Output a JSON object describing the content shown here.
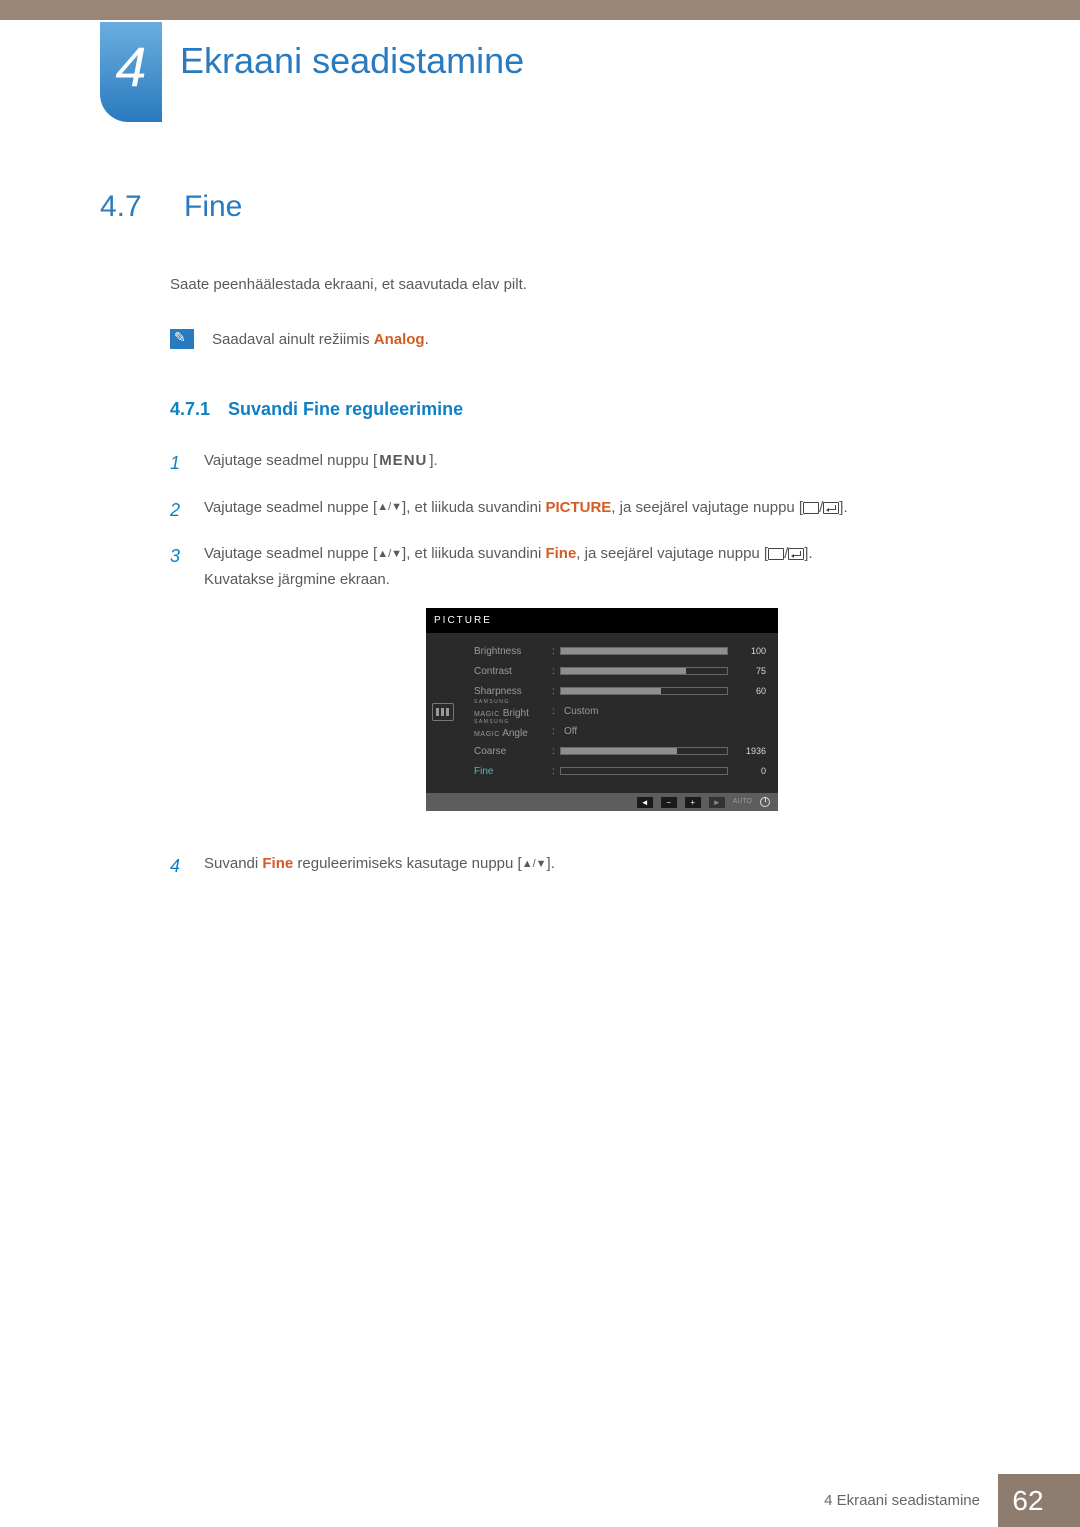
{
  "chapter": {
    "number": "4",
    "title": "Ekraani seadistamine"
  },
  "section": {
    "number": "4.7",
    "title": "Fine"
  },
  "intro": "Saate peenhäälestada ekraani, et saavutada elav pilt.",
  "note": {
    "prefix": "Saadaval ainult režiimis ",
    "keyword": "Analog",
    "suffix": "."
  },
  "subsection": {
    "number": "4.7.1",
    "title": "Suvandi Fine reguleerimine"
  },
  "keys": {
    "menu": "MENU"
  },
  "steps": {
    "s1": {
      "n": "1",
      "text_a": "Vajutage seadmel nuppu [",
      "text_b": "]."
    },
    "s2": {
      "n": "2",
      "a": "Vajutage seadmel nuppe [",
      "b": "], et liikuda suvandini ",
      "kw": "PICTURE",
      "c": ", ja seejärel vajutage nuppu [",
      "d": "]."
    },
    "s3": {
      "n": "3",
      "a": "Vajutage seadmel nuppe [",
      "b": "], et liikuda suvandini ",
      "kw": "Fine",
      "c": ", ja seejärel vajutage nuppu [",
      "d": "].",
      "after": "Kuvatakse järgmine ekraan."
    },
    "s4": {
      "n": "4",
      "a": "Suvandi ",
      "kw": "Fine",
      "b": " reguleerimiseks kasutage nuppu [",
      "c": "]."
    }
  },
  "osd": {
    "header": "PICTURE",
    "rows": {
      "brightness": {
        "label": "Brightness",
        "value": "100",
        "pct": 100
      },
      "contrast": {
        "label": "Contrast",
        "value": "75",
        "pct": 75
      },
      "sharpness": {
        "label": "Sharpness",
        "value": "60",
        "pct": 60
      },
      "magic_bright": {
        "label_top": "SAMSUNG",
        "label_bottom": "MAGIC",
        "suffix": "Bright",
        "value": "Custom"
      },
      "magic_angle": {
        "label_top": "SAMSUNG",
        "label_bottom": "MAGIC",
        "suffix": "Angle",
        "value": "Off"
      },
      "coarse": {
        "label": "Coarse",
        "value": "1936",
        "pct": 70
      },
      "fine": {
        "label": "Fine",
        "value": "0",
        "pct": 0
      }
    },
    "footer": {
      "auto": "AUTO"
    }
  },
  "footer": {
    "label": "4 Ekraani seadistamine",
    "page": "62"
  }
}
